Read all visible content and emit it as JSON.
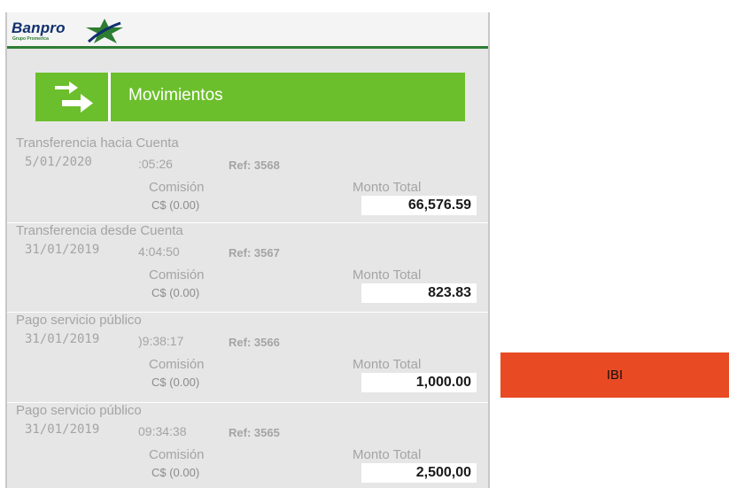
{
  "brand": {
    "name": "Banpro",
    "sub": "Grupo Promerica",
    "accent": "#6cbf2c"
  },
  "header": {
    "label": "Movimientos",
    "icon": "transfer-arrows-icon"
  },
  "transactions": [
    {
      "title": "Transferencia hacia Cuenta",
      "date": "5/01/2020",
      "time": ":05:26",
      "ref": "Ref: 3568",
      "commission_label": "Comisión",
      "commission": "C$ (0.00)",
      "total_label": "Monto Total",
      "amount": "66,576.59"
    },
    {
      "title": "Transferencia desde Cuenta",
      "date": "31/01/2019",
      "time": "4:04:50",
      "ref": "Ref: 3567",
      "commission_label": "Comisión",
      "commission": "C$ (0.00)",
      "total_label": "Monto Total",
      "amount": "823.83"
    },
    {
      "title": "Pago servicio público",
      "date": "31/01/2019",
      "time": ")9:38:17",
      "ref": "Ref: 3566",
      "commission_label": "Comisión",
      "commission": "C$ (0.00)",
      "total_label": "Monto Total",
      "amount": "1,000.00"
    },
    {
      "title": "Pago servicio público",
      "date": "31/01/2019",
      "time": "09:34:38",
      "ref": "Ref: 3565",
      "commission_label": "Comisión",
      "commission": "C$ (0.00)",
      "total_label": "Monto Total",
      "amount": "2,500,00"
    }
  ],
  "tag": {
    "label": "IBI",
    "color": "#e84b24"
  }
}
